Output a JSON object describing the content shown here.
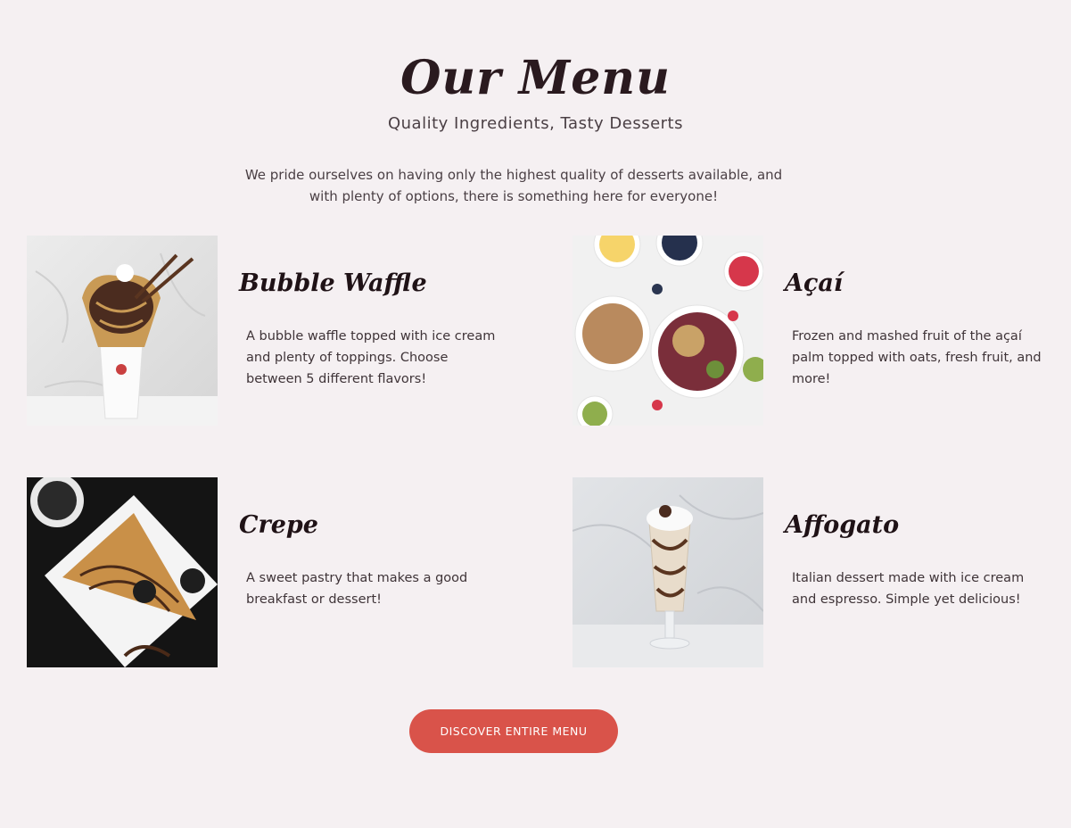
{
  "header": {
    "title": "Our Menu",
    "subtitle": "Quality Ingredients, Tasty Desserts",
    "intro": "We pride ourselves on having only the highest quality of desserts available, and with plenty of options, there is something here for everyone!"
  },
  "menu": {
    "items": [
      {
        "name": "Bubble Waffle",
        "description": "A bubble waffle topped with ice cream and plenty of toppings. Choose between 5 different flavors!",
        "image": "bubble-waffle-photo"
      },
      {
        "name": "Açaí",
        "description": "Frozen and mashed fruit of the açaí palm topped with oats, fresh fruit, and more!",
        "image": "acai-bowl-photo"
      },
      {
        "name": "Crepe",
        "description": "A sweet pastry that makes a good breakfast or dessert!",
        "image": "crepe-photo"
      },
      {
        "name": "Affogato",
        "description": "Italian dessert made with ice cream and espresso. Simple yet delicious!",
        "image": "affogato-photo"
      }
    ]
  },
  "cta": {
    "label": "DISCOVER ENTIRE MENU"
  },
  "colors": {
    "background": "#f5f0f2",
    "accent": "#d9534a",
    "heading": "#2a1a1f"
  }
}
